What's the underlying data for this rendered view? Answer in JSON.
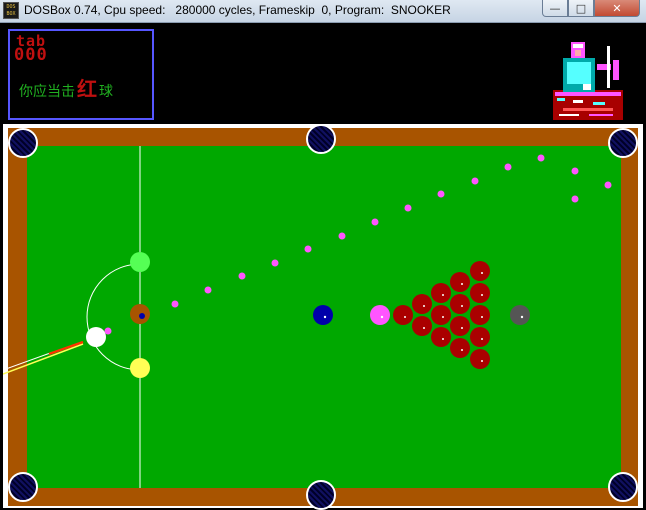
{
  "window": {
    "icon_label": "DOS BOX",
    "title": "DOSBox 0.74, Cpu speed:   280000 cycles, Frameskip  0, Program:  SNOOKER",
    "minimize_glyph": "—",
    "maximize_glyph": "□",
    "close_glyph": "✕"
  },
  "hud": {
    "player_name": "tab",
    "score": "000",
    "prompt_before": "你应当击",
    "prompt_target": "红",
    "prompt_after": "球"
  },
  "colors": {
    "cloth": "#00a800",
    "rail": "#a85400",
    "hud_border": "#5656ff",
    "score_text": "#c01010",
    "prompt_text": "#20b020",
    "aim_dot": "#ff55ff"
  },
  "icons": [
    "app-icon",
    "player-portrait"
  ]
}
